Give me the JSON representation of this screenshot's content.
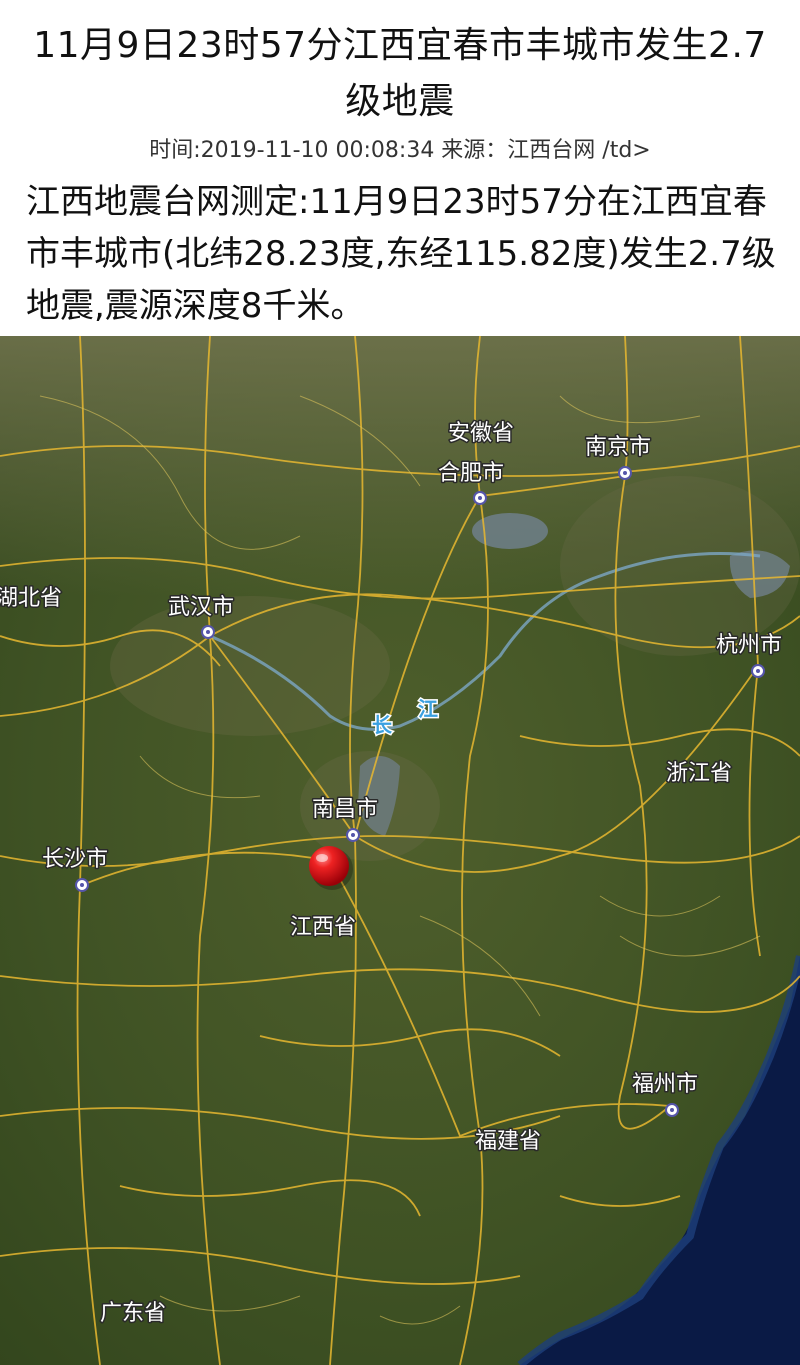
{
  "article": {
    "title": "11月9日23时57分江西宜春市丰城市发生2.7级地震",
    "meta": "时间:2019-11-10 00:08:34 来源：江西台网 /td>",
    "body": "江西地震台网测定:11月9日23时57分在江西宜春市丰城市(北纬28.23度,东经115.82度)发生2.7级地震,震源深度8千米。"
  },
  "map": {
    "province_labels": {
      "anhui": "安徽省",
      "hubei": "湖北省",
      "zhejiang": "浙江省",
      "jiangxi": "江西省",
      "fujian": "福建省",
      "guangdong": "广东省"
    },
    "city_labels": {
      "nanjing": "南京市",
      "hefei": "合肥市",
      "wuhan": "武汉市",
      "hangzhou": "杭州市",
      "nanchang": "南昌市",
      "changsha": "长沙市",
      "fuzhou": "福州市"
    },
    "river_labels": {
      "chang": "长",
      "jiang": "江"
    },
    "epicenter_color": "#e0101a",
    "land_color": "#4a5a2a",
    "sea_color": "#0a1a45",
    "road_color": "#e8b830"
  }
}
